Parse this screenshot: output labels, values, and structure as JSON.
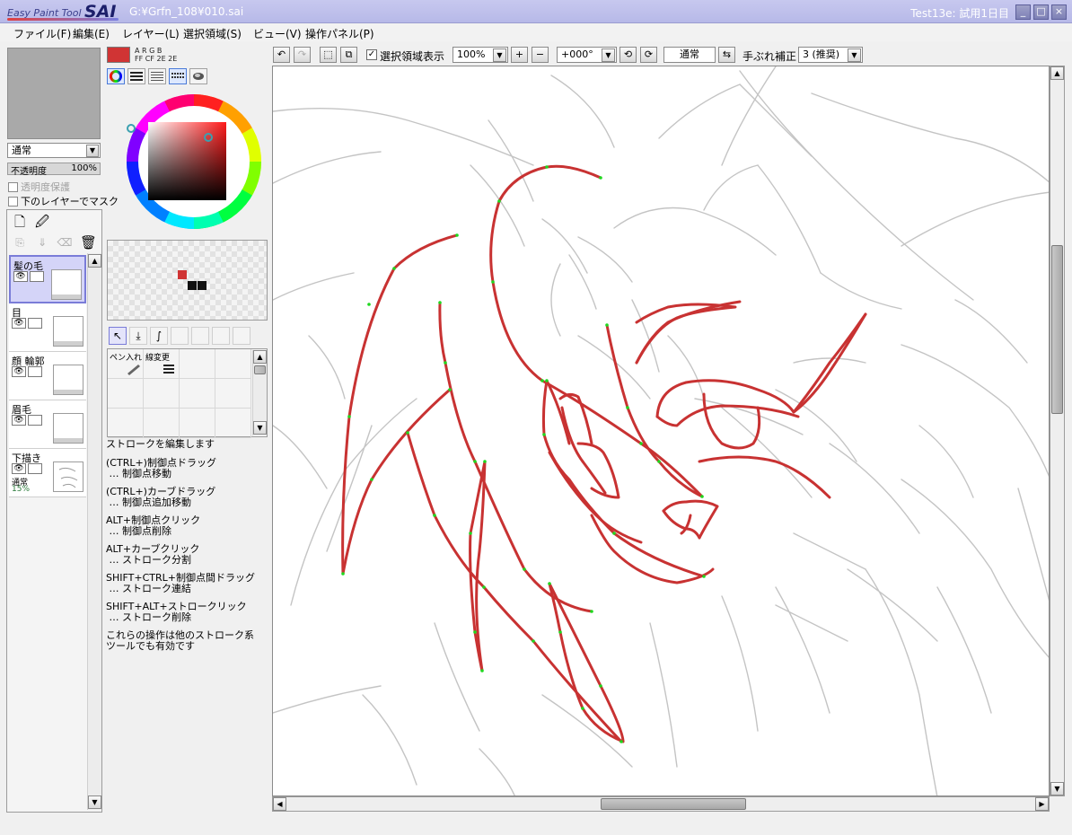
{
  "app": {
    "logo_small": "Easy Paint Tool",
    "logo_big": "SAI",
    "file_path": "G:¥Grfn_108¥010.sai",
    "license": "Test13e: 試用1日目",
    "btn_min": "_",
    "btn_max": "□",
    "btn_close": "×"
  },
  "menu": [
    "ファイル(F)",
    "編集(E)",
    "レイヤー(L)",
    "選択領域(S)",
    "ビュー(V)",
    "操作パネル(P)"
  ],
  "layer_props": {
    "blend_mode": "通常",
    "opacity_label": "不透明度",
    "opacity_value": "100%",
    "preserve_opacity": "透明度保護",
    "clip_mask": "下のレイヤーでマスク"
  },
  "layers": [
    {
      "name": "髪の毛",
      "selected": true
    },
    {
      "name": "目",
      "selected": false
    },
    {
      "name": "顔 輪郭",
      "selected": false
    },
    {
      "name": "眉毛",
      "selected": false
    },
    {
      "name": "下描き",
      "mode": "通常",
      "opacity": "15%",
      "selected": false
    }
  ],
  "color": {
    "main_color": "#d03434",
    "argb_header": "A R G B",
    "argb_values": "FF CF 2E 2E"
  },
  "icons": {
    "new_layer": "🗋",
    "new_linework": "🖉",
    "delete": "🗑",
    "select": "↖",
    "pen_in": "⤓",
    "curve": "∫",
    "eye": "👁"
  },
  "tools": {
    "pen_label": "ペン入れ",
    "width_label": "線変更"
  },
  "help": [
    "ストロークを編集します",
    "(CTRL+)制御点ドラッグ\n … 制御点移動",
    "(CTRL+)カーブドラッグ\n … 制御点追加移動",
    "ALT+制御点クリック\n … 制御点削除",
    "ALT+カーブクリック\n … ストローク分割",
    "SHIFT+CTRL+制御点間ドラッグ\n … ストローク連結",
    "SHIFT+ALT+ストロークリック\n … ストローク削除",
    "これらの操作は他のストローク系\nツールでも有効です"
  ],
  "toolbar": {
    "show_selection": "選択領域表示",
    "zoom": "100%",
    "zoom_in": "+",
    "zoom_out": "−",
    "rotation": "+000°",
    "mode": "通常",
    "stabilizer_label": "手ぶれ補正",
    "stabilizer_value": "3 (推奨)"
  },
  "scroll": {
    "up": "▲",
    "down": "▼",
    "left": "◀",
    "right": "▶",
    "dropdown": "▼"
  },
  "colors": {
    "title_bg": "#b7b9e8",
    "stroke_red": "#c83232",
    "control_point": "#1fd81f",
    "sketch_gray": "#bdbdbd"
  }
}
